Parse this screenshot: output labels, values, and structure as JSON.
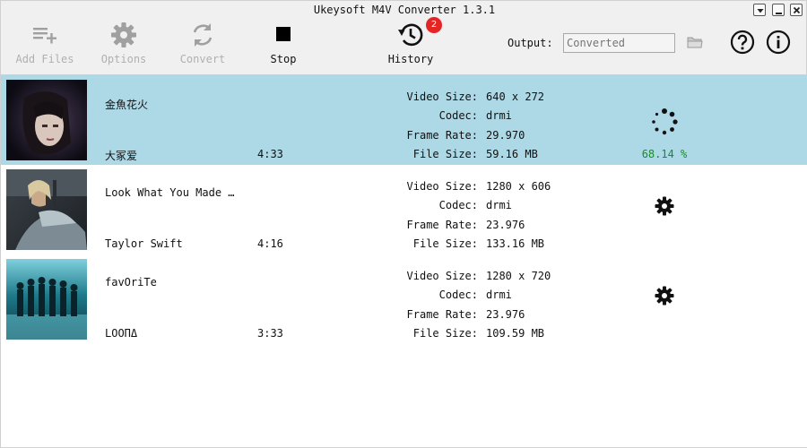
{
  "window": {
    "title": "Ukeysoft M4V Converter 1.3.1"
  },
  "window_buttons": [
    {
      "name": "menu-dropdown-button",
      "icon": "chevron-down-icon"
    },
    {
      "name": "minimize-button",
      "icon": "minimize-icon"
    },
    {
      "name": "close-button",
      "icon": "close-icon"
    }
  ],
  "toolbar": {
    "add_files": {
      "label": "Add Files",
      "icon": "add-list-icon",
      "enabled": false
    },
    "options": {
      "label": "Options",
      "icon": "gear-icon",
      "enabled": false
    },
    "convert": {
      "label": "Convert",
      "icon": "refresh-icon",
      "enabled": false
    },
    "stop": {
      "label": "Stop",
      "icon": "stop-icon",
      "enabled": true
    },
    "history": {
      "label": "History",
      "icon": "history-icon",
      "enabled": true,
      "badge": "2"
    }
  },
  "output": {
    "label": "Output:",
    "placeholder": "Converted",
    "value": ""
  },
  "help_icon": "question-icon",
  "info_icon": "info-icon",
  "labels": {
    "video_size": "Video Size:",
    "codec": "Codec:",
    "frame_rate": "Frame Rate:",
    "file_size": "File Size:"
  },
  "items": [
    {
      "title": "金魚花火",
      "artist": "大冢爱",
      "duration": "4:33",
      "video_size": "640 x 272",
      "codec": "drmi",
      "frame_rate": "29.970",
      "file_size": "59.16 MB",
      "status": "converting",
      "progress": "68.14 %",
      "selected": true,
      "thumb_colors": [
        "#0c0a12",
        "#5a4a6a",
        "#d8c8c0"
      ]
    },
    {
      "title": "Look What You Made …",
      "artist": "Taylor Swift",
      "duration": "4:16",
      "video_size": "1280 x 606",
      "codec": "drmi",
      "frame_rate": "23.976",
      "file_size": "133.16 MB",
      "status": "pending",
      "selected": false,
      "thumb_colors": [
        "#2b2f33",
        "#6b7a84",
        "#c9d3d8"
      ]
    },
    {
      "title": "favOriTe",
      "artist": "LOOΠΔ",
      "duration": "3:33",
      "video_size": "1280 x 720",
      "codec": "drmi",
      "frame_rate": "23.976",
      "file_size": "109.59 MB",
      "status": "pending",
      "selected": false,
      "thumb_colors": [
        "#0c3540",
        "#1e7a8a",
        "#7fd0dc"
      ]
    }
  ]
}
